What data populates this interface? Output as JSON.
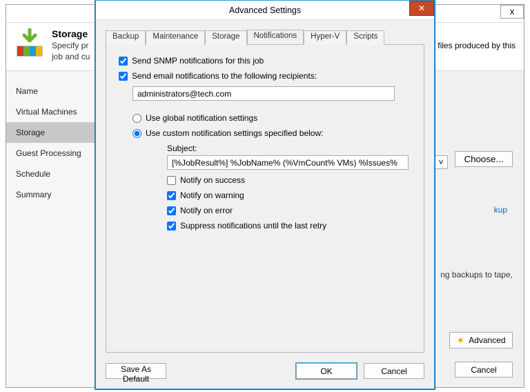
{
  "wizard": {
    "title": "Storage",
    "subtitle_partial": "Specify pr",
    "subtitle2_partial": "job and cu",
    "subtitle_tail": "files produced by this",
    "close": "x",
    "nav": [
      {
        "label": "Name"
      },
      {
        "label": "Virtual Machines"
      },
      {
        "label": "Storage",
        "selected": true
      },
      {
        "label": "Guest Processing"
      },
      {
        "label": "Schedule"
      },
      {
        "label": "Summary"
      }
    ],
    "choose": "Choose...",
    "link_tail": "kup",
    "tape_tail": "ng backups to tape,",
    "advanced": "Advanced",
    "cancel": "Cancel"
  },
  "dialog": {
    "title": "Advanced Settings",
    "tabs": [
      "Backup",
      "Maintenance",
      "Storage",
      "Notifications",
      "Hyper-V",
      "Scripts"
    ],
    "active_tab": "Notifications",
    "snmp_label": "Send SNMP notifications for this job",
    "email_label": "Send email notifications to the following recipients:",
    "email_value": "administrators@tech.com",
    "global_label": "Use global notification settings",
    "custom_label": "Use custom notification settings specified below:",
    "subject_label": "Subject:",
    "subject_value": "[%JobResult%] %JobName% (%VmCount% VMs) %Issues%",
    "notify_success": "Notify on success",
    "notify_warning": "Notify on warning",
    "notify_error": "Notify on error",
    "suppress": "Suppress notifications until the last retry",
    "save_default": "Save As Default",
    "ok": "OK",
    "cancel": "Cancel",
    "snmp_checked": true,
    "email_checked": true,
    "global_checked": false,
    "custom_checked": true,
    "ns_checked": false,
    "nw_checked": true,
    "ne_checked": true,
    "sup_checked": true
  }
}
